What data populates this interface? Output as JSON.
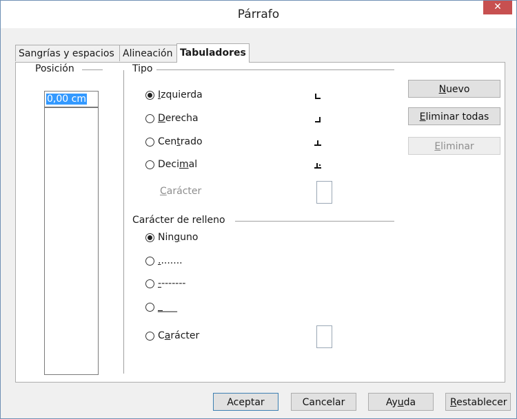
{
  "window": {
    "title": "Párrafo",
    "close_glyph": "✕"
  },
  "tabs": [
    {
      "label": "Sangrías y espacios",
      "active": false
    },
    {
      "label": "Alineación",
      "active": false
    },
    {
      "label": "Tabuladores",
      "active": true
    }
  ],
  "position": {
    "title": "Posición",
    "value": "0,00 cm"
  },
  "tipo": {
    "title": "Tipo",
    "options": [
      {
        "pre": "",
        "key": "I",
        "post": "zquierda",
        "checked": true,
        "icon": "tab-left-icon"
      },
      {
        "pre": "",
        "key": "D",
        "post": "erecha",
        "checked": false,
        "icon": "tab-right-icon"
      },
      {
        "pre": "Cen",
        "key": "t",
        "post": "rado",
        "checked": false,
        "icon": "tab-center-icon"
      },
      {
        "pre": "Deci",
        "key": "m",
        "post": "al",
        "checked": false,
        "icon": "tab-decimal-icon"
      }
    ],
    "character_label": {
      "key": "C",
      "post": "arácter"
    }
  },
  "fill": {
    "title": "Carácter de relleno",
    "options": [
      {
        "pre": "Nin",
        "key": "g",
        "post": "uno",
        "checked": true
      },
      {
        "pre": "",
        "key": ".",
        "post": ".......",
        "checked": false
      },
      {
        "pre": "",
        "key": "-",
        "post": "-------",
        "checked": false
      },
      {
        "pre": "",
        "key": "_",
        "post": "___",
        "checked": false
      },
      {
        "pre": "C",
        "key": "a",
        "post": "rácter",
        "checked": false
      }
    ]
  },
  "side_buttons": {
    "new": {
      "pre": "",
      "key": "N",
      "post": "uevo"
    },
    "delete_all": {
      "pre": "",
      "key": "E",
      "post": "liminar todas"
    },
    "delete": {
      "pre": "",
      "key": "E",
      "post": "liminar",
      "disabled": true
    }
  },
  "footer": {
    "ok": {
      "pre": "Aceptar",
      "key": "",
      "post": ""
    },
    "cancel": {
      "pre": "Cancelar",
      "key": "",
      "post": ""
    },
    "help": {
      "pre": "Ay",
      "key": "u",
      "post": "da"
    },
    "reset": {
      "pre": "",
      "key": "R",
      "post": "establecer"
    }
  },
  "colors": {
    "selection": "#3399ff",
    "close": "#c75050",
    "border": "#6e8fb4"
  }
}
